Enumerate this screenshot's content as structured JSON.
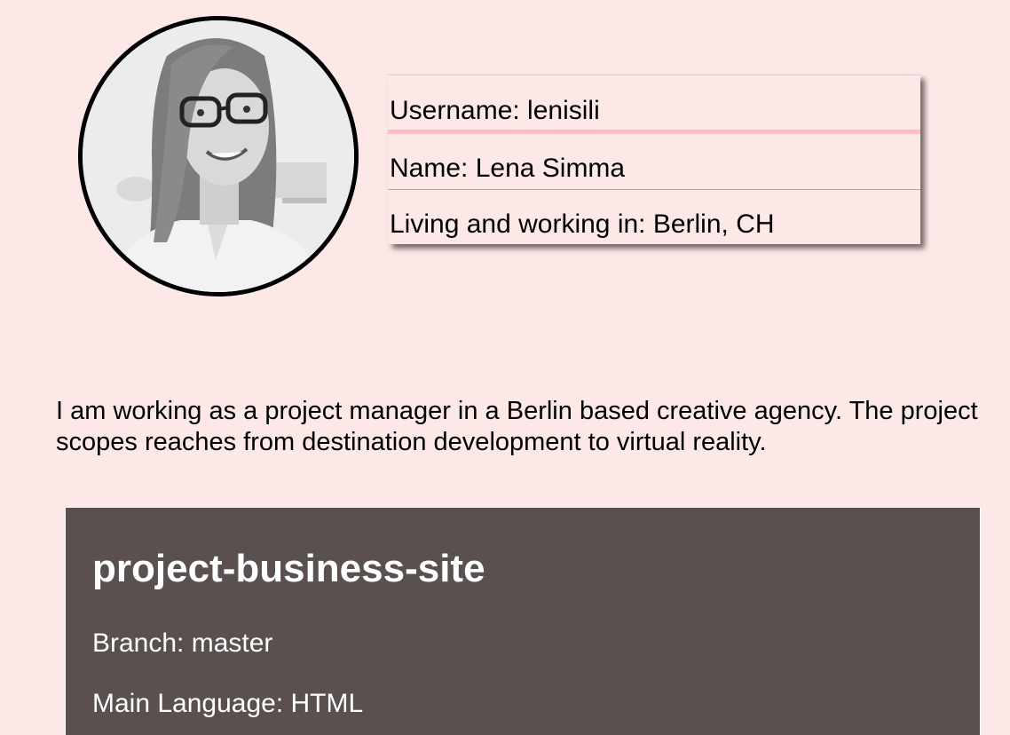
{
  "profile": {
    "avatar_alt": "Lena Simma",
    "username": "Username: lenisili",
    "name": "Name: Lena Simma",
    "location": "Living and working in: Berlin, CH",
    "bio": "I am working as a project manager in a Berlin based creative agency. The project scopes reaches from destination development to virtual reality."
  },
  "repo": {
    "title": "project-business-site",
    "branch": "Branch: master",
    "language": "Main Language: HTML"
  },
  "colors": {
    "background": "#fde8e8",
    "accent_pink": "#f9bfca",
    "repo_card": "#5b5050"
  }
}
